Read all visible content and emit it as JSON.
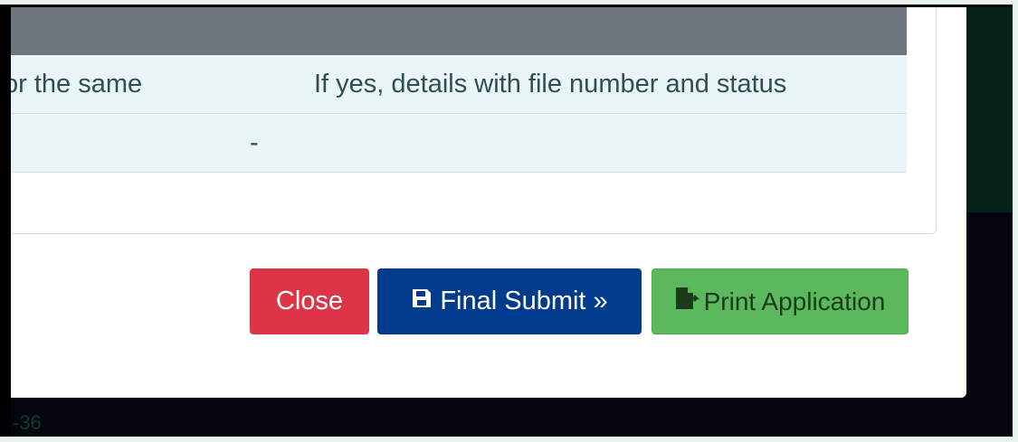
{
  "table": {
    "subheader_col1": "or the same",
    "subheader_col2": "If yes, details with file number and status",
    "row_value": "-"
  },
  "buttons": {
    "close": "Close",
    "final_submit": "Final Submit »",
    "print_application": "Print Application"
  },
  "icons": {
    "final_submit": "save-icon",
    "print_application": "file-export-icon"
  },
  "footer": {
    "number": "-36"
  },
  "colors": {
    "close": "#dc3545",
    "final_submit": "#003b8e",
    "print_application": "#5cb85c",
    "table_header": "#6c757d",
    "table_row": "#e9f5f6"
  }
}
